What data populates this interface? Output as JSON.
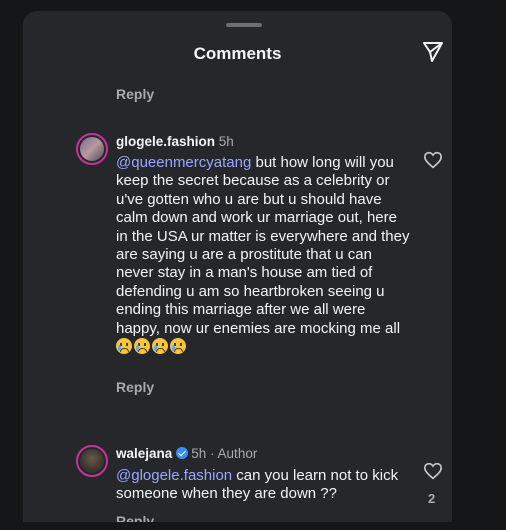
{
  "header": {
    "title": "Comments"
  },
  "top_reply": {
    "label": "Reply"
  },
  "comments": [
    {
      "username": "glogele.fashion",
      "time": "5h",
      "mention": "@queenmercyatang",
      "text": " but how long will you keep the secret because as a celebrity or u've gotten who u are but u should have calm down and work ur marriage out, here in the USA ur matter is everywhere and they are saying u are a prostitute that u can never stay in a man's house am tied of defending u am so heartbroken seeing u ending this marriage after we all were happy, now ur enemies are mocking me all",
      "emoji_count": 4,
      "emoji_name": "crying-face-emoji",
      "reply_label": "Reply"
    },
    {
      "username": "walejana",
      "time": "5h · Author",
      "verified": true,
      "mention": "@glogele.fashion",
      "text": " can you learn not to kick someone when they are down ??",
      "likes": "2",
      "reply_label": "Reply"
    }
  ],
  "icons": {
    "send": "send-icon",
    "like": "heart-icon",
    "verified": "verified-badge-icon"
  },
  "colors": {
    "background": "#25272b",
    "mention": "#9aa7ff",
    "avatar_ring": "#c9329b"
  }
}
